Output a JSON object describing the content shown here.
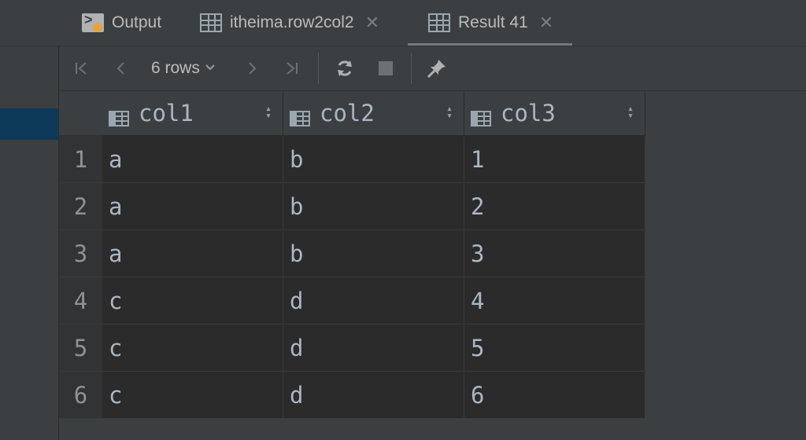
{
  "tabs": [
    {
      "label": "Output",
      "icon": "console-icon",
      "closable": false,
      "active": false
    },
    {
      "label": "itheima.row2col2",
      "icon": "table-icon",
      "closable": true,
      "active": false
    },
    {
      "label": "Result 41",
      "icon": "table-icon",
      "closable": true,
      "active": true
    }
  ],
  "tab_close_glyph": "✕",
  "toolbar": {
    "first": "⏮",
    "prev": "‹",
    "rows_label": "6 rows",
    "next": "›",
    "last": "⏭",
    "icons": [
      "first-page-icon",
      "prev-page-icon",
      "next-page-icon",
      "last-page-icon",
      "refresh-icon",
      "stop-icon",
      "pin-icon"
    ]
  },
  "table": {
    "columns": [
      "col1",
      "col2",
      "col3"
    ],
    "row_numbers": [
      "1",
      "2",
      "3",
      "4",
      "5",
      "6"
    ],
    "rows": [
      [
        "a",
        "b",
        "1"
      ],
      [
        "a",
        "b",
        "2"
      ],
      [
        "a",
        "b",
        "3"
      ],
      [
        "c",
        "d",
        "4"
      ],
      [
        "c",
        "d",
        "5"
      ],
      [
        "c",
        "d",
        "6"
      ]
    ]
  },
  "colors": {
    "accent": "#0d3a58",
    "background": "#2b2b2b",
    "panel": "#3c3f41"
  }
}
